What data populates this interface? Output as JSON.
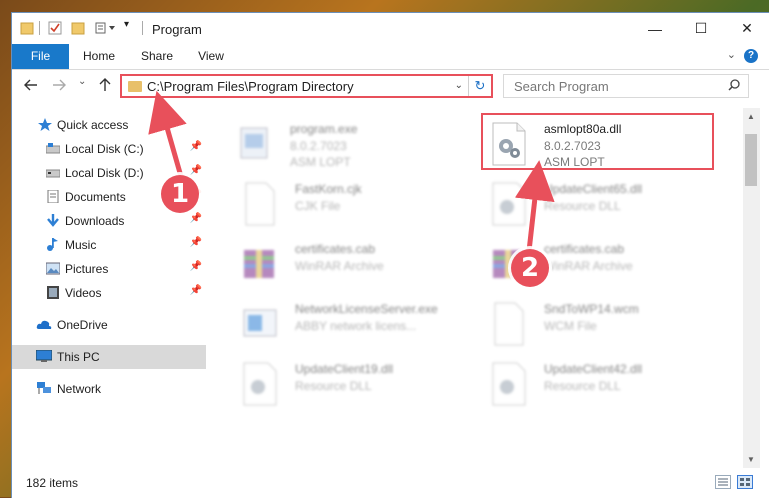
{
  "window": {
    "title": "Program",
    "controls": {
      "minimize": "—",
      "maximize": "☐",
      "close": "✕"
    }
  },
  "ribbon": {
    "tabs": [
      {
        "label": "File"
      },
      {
        "label": "Home"
      },
      {
        "label": "Share"
      },
      {
        "label": "View"
      }
    ],
    "help": "?"
  },
  "address": {
    "path": "C:\\Program Files\\Program Directory",
    "search_placeholder": "Search Program"
  },
  "nav": {
    "quick_access": "Quick access",
    "items": [
      {
        "label": "Local Disk (C:)",
        "icon": "drive-icon"
      },
      {
        "label": "Local Disk (D:)",
        "icon": "drive-icon"
      },
      {
        "label": "Documents",
        "icon": "documents-icon"
      },
      {
        "label": "Downloads",
        "icon": "downloads-icon"
      },
      {
        "label": "Music",
        "icon": "music-icon"
      },
      {
        "label": "Pictures",
        "icon": "pictures-icon"
      },
      {
        "label": "Videos",
        "icon": "videos-icon"
      }
    ],
    "onedrive": "OneDrive",
    "this_pc": "This PC",
    "network": "Network"
  },
  "files": [
    {
      "name": "program.exe",
      "line1": "8.0.2.7023",
      "line2": "ASM LOPT",
      "icon": "exe-icon"
    },
    {
      "name": "asmlopt80a.dll",
      "line1": "8.0.2.7023",
      "line2": "ASM LOPT",
      "icon": "dll-icon"
    },
    {
      "name": "FastKorn.cjk",
      "line1": "CJK File",
      "line2": "",
      "icon": "file-icon"
    },
    {
      "name": "UpdateClient65.dll",
      "line1": "Resource DLL",
      "line2": "",
      "icon": "dll-icon"
    },
    {
      "name": "certificates.cab",
      "line1": "WinRAR Archive",
      "line2": "",
      "icon": "archive-icon"
    },
    {
      "name": "certificates.cab",
      "line1": "WinRAR Archive",
      "line2": "",
      "icon": "archive-icon"
    },
    {
      "name": "NetworkLicenseServer.exe",
      "line1": "ABBY network licens...",
      "line2": "",
      "icon": "exe-icon"
    },
    {
      "name": "SndToWP14.wcm",
      "line1": "WCM File",
      "line2": "",
      "icon": "file-icon"
    },
    {
      "name": "UpdateClient19.dll",
      "line1": "Resource DLL",
      "line2": "",
      "icon": "dll-icon"
    },
    {
      "name": "UpdateClient42.dll",
      "line1": "Resource DLL",
      "line2": "",
      "icon": "dll-icon"
    }
  ],
  "status": {
    "items": "182 items"
  },
  "callouts": {
    "one": "1",
    "two": "2"
  },
  "colors": {
    "accent": "#1979ca",
    "highlight": "#e8505b"
  }
}
